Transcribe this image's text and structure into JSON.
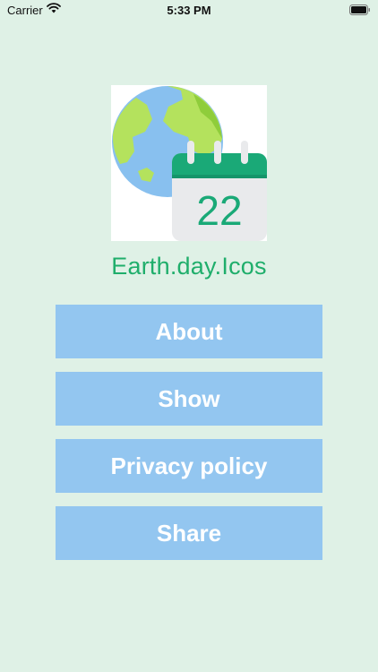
{
  "status_bar": {
    "carrier": "Carrier",
    "time": "5:33 PM",
    "wifi_icon": "wifi-icon",
    "battery_icon": "battery-icon"
  },
  "logo": {
    "day_number": "22",
    "icon": "earth-calendar-logo-icon"
  },
  "app_title": "Earth.day.Icos",
  "menu": {
    "about_label": "About",
    "show_label": "Show",
    "privacy_label": "Privacy policy",
    "share_label": "Share"
  },
  "colors": {
    "background": "#dff1e6",
    "title_green": "#1fae6b",
    "button_blue": "#93c6f0",
    "button_text": "#ffffff"
  }
}
